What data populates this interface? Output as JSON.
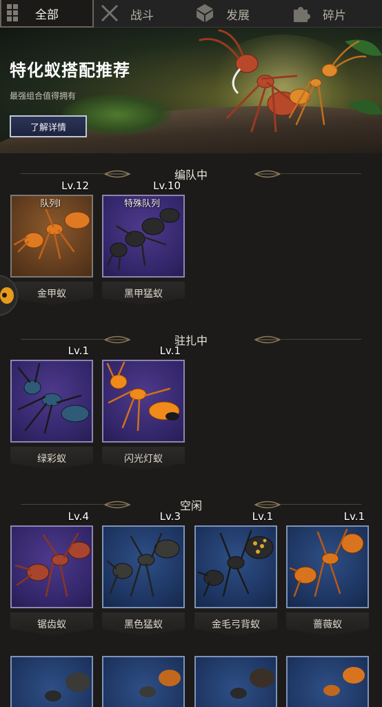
{
  "tabs": [
    {
      "label": "全部",
      "icon": "grid-icon",
      "active": true
    },
    {
      "label": "战斗",
      "icon": "swords-icon",
      "active": false
    },
    {
      "label": "发展",
      "icon": "cube-icon",
      "active": false
    },
    {
      "label": "碎片",
      "icon": "puzzle-icon",
      "active": false
    }
  ],
  "banner": {
    "title": "特化蚁搭配推荐",
    "subtitle": "最强组合值得拥有",
    "button_label": "了解详情"
  },
  "sections": {
    "formation": {
      "title": "编队中",
      "cards": [
        {
          "tag": "队列I",
          "level": "Lv.12",
          "name": "金甲蚁",
          "tile_color": "orange",
          "ant_color": "#e07a22"
        },
        {
          "tag": "特殊队列",
          "level": "Lv.10",
          "name": "黑甲猛蚁",
          "tile_color": "purple",
          "ant_color": "#2a2a2a"
        }
      ]
    },
    "stationed": {
      "title": "驻扎中",
      "cards": [
        {
          "tag": "",
          "level": "Lv.1",
          "name": "绿彩蚁",
          "tile_color": "purple",
          "ant_color": "#2f5a78"
        },
        {
          "tag": "",
          "level": "Lv.1",
          "name": "闪光灯蚁",
          "tile_color": "purple",
          "ant_color": "#f08a1a"
        }
      ]
    },
    "idle": {
      "title": "空闲",
      "cards": [
        {
          "tag": "",
          "level": "Lv.4",
          "name": "锯齿蚁",
          "tile_color": "purple",
          "ant_color": "#a8452e"
        },
        {
          "tag": "",
          "level": "Lv.3",
          "name": "黑色猛蚁",
          "tile_color": "blue",
          "ant_color": "#3a3a36"
        },
        {
          "tag": "",
          "level": "Lv.1",
          "name": "金毛弓背蚁",
          "tile_color": "blue",
          "ant_color": "#2a2a2a"
        },
        {
          "tag": "",
          "level": "Lv.1",
          "name": "蔷薇蚁",
          "tile_color": "blue",
          "ant_color": "#d9741e"
        }
      ]
    }
  },
  "colors": {
    "background": "#1c1b1a",
    "accent_gold": "#8a7a5a",
    "button_fill": "#2c3457"
  }
}
